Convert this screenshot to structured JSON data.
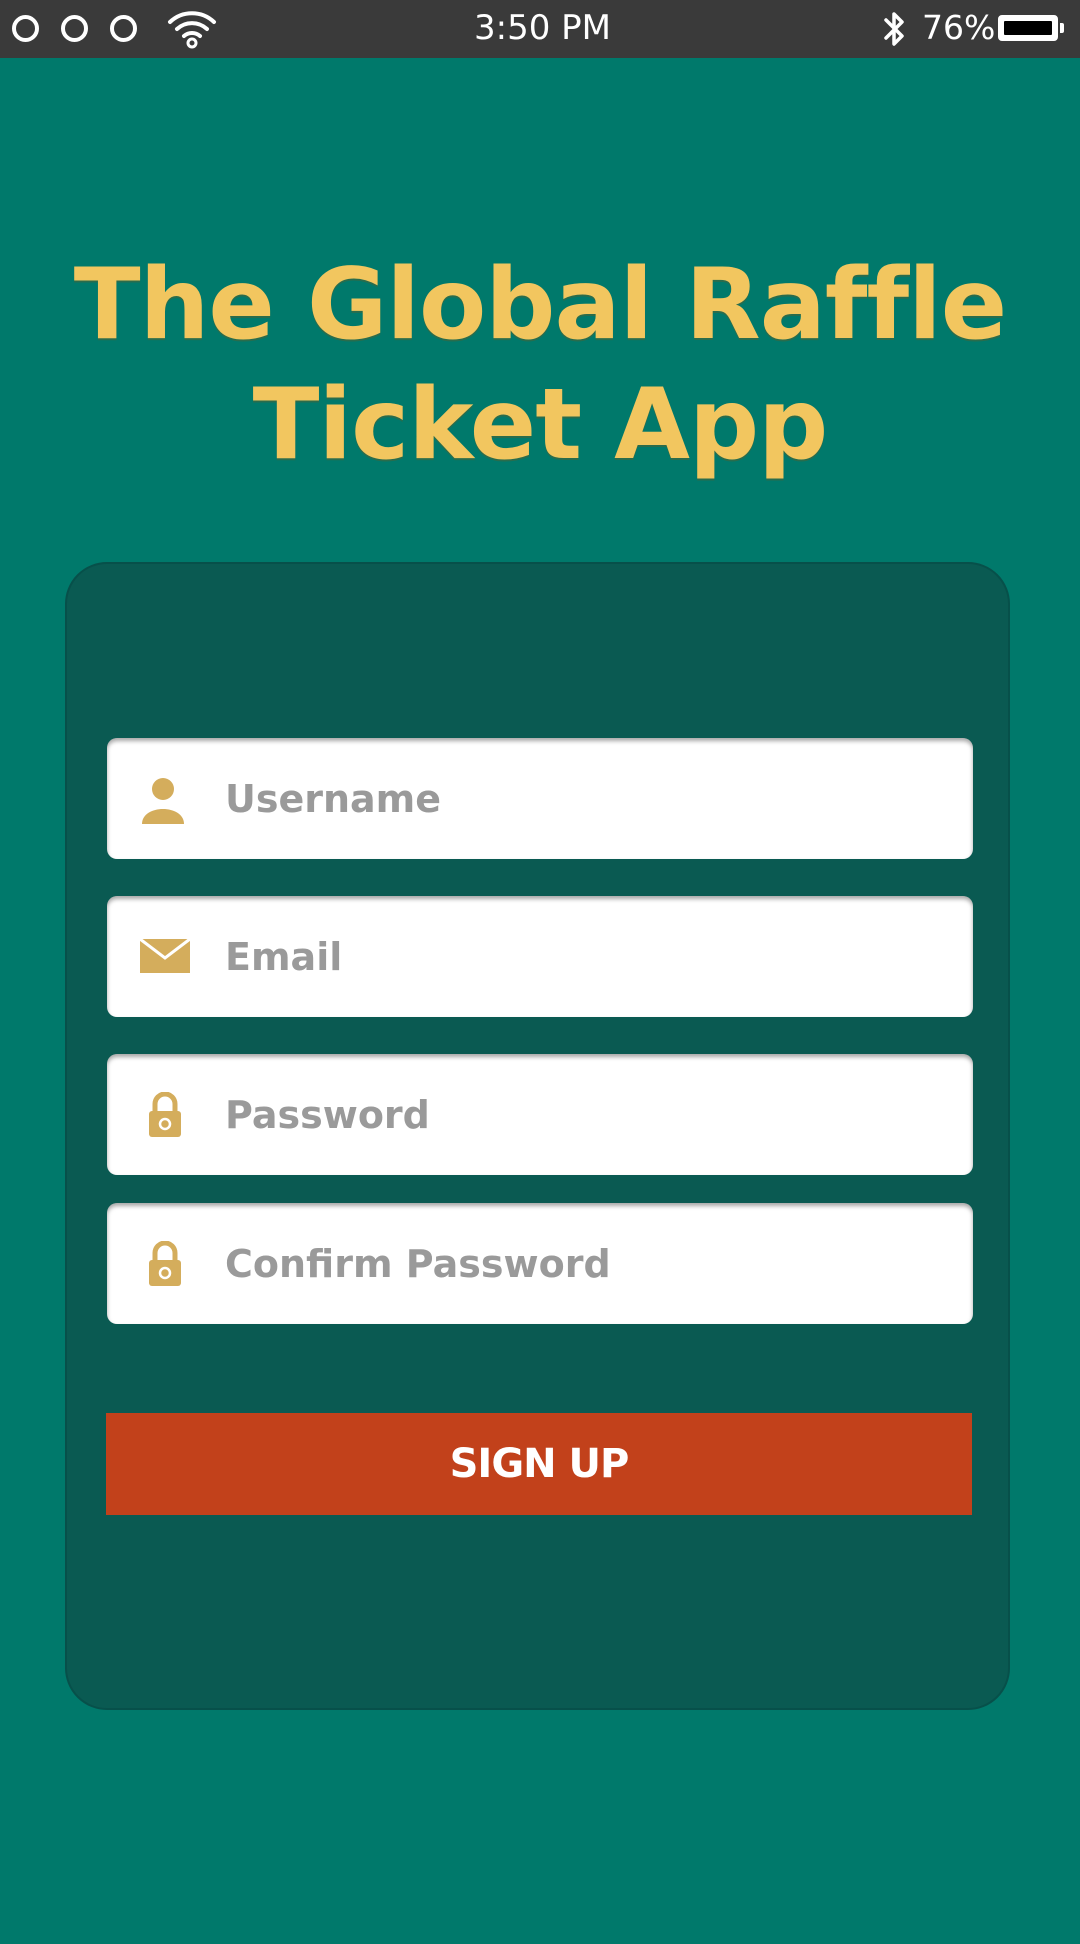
{
  "status_bar": {
    "time": "3:50 PM",
    "battery_percent": "76%",
    "icons": [
      "circle-icon",
      "circle-icon",
      "circle-icon",
      "wifi-icon",
      "bluetooth-icon",
      "battery-icon"
    ]
  },
  "app": {
    "title_line1": "The Global Raffle",
    "title_line2": "Ticket App"
  },
  "form": {
    "username_placeholder": "Username",
    "email_placeholder": "Email",
    "password_placeholder": "Password",
    "confirm_password_placeholder": "Confirm Password",
    "icons": [
      "user-icon",
      "envelope-icon",
      "lock-icon",
      "lock-icon"
    ],
    "signup_label": "SIGN UP"
  },
  "colors": {
    "background": "#00796b",
    "card": "#0a5a52",
    "title_gold": "#f2c65f",
    "icon_gold": "#d4ad5c",
    "button": "#c2411b",
    "status_bar": "#3a3a3a"
  }
}
